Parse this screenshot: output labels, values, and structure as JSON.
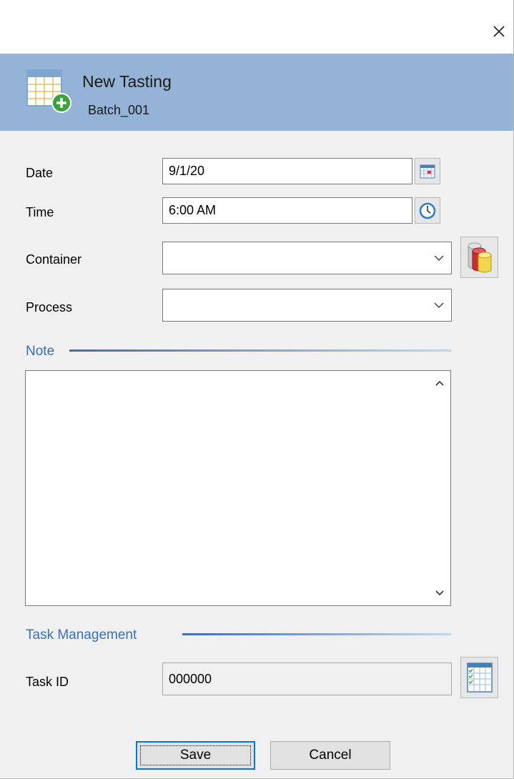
{
  "header": {
    "title": "New Tasting",
    "subtitle": "Batch_001"
  },
  "form": {
    "date": {
      "label": "Date",
      "value": "9/1/20"
    },
    "time": {
      "label": "Time",
      "value": "6:00 AM"
    },
    "container": {
      "label": "Container",
      "value": ""
    },
    "process": {
      "label": "Process",
      "value": ""
    }
  },
  "note": {
    "section_label": "Note",
    "value": ""
  },
  "task": {
    "section_label": "Task Management",
    "id_label": "Task ID",
    "id_value": "000000"
  },
  "buttons": {
    "save": "Save",
    "cancel": "Cancel"
  },
  "icons": {
    "close": "close-icon",
    "header": "new-table-icon",
    "calendar": "calendar-icon",
    "clock": "clock-icon",
    "containers": "containers-icon",
    "task_grid": "task-grid-icon"
  },
  "colors": {
    "header_band": "#95b3d7",
    "section_accent": "#3b6fb0",
    "default_button_border": "#0078d7"
  }
}
